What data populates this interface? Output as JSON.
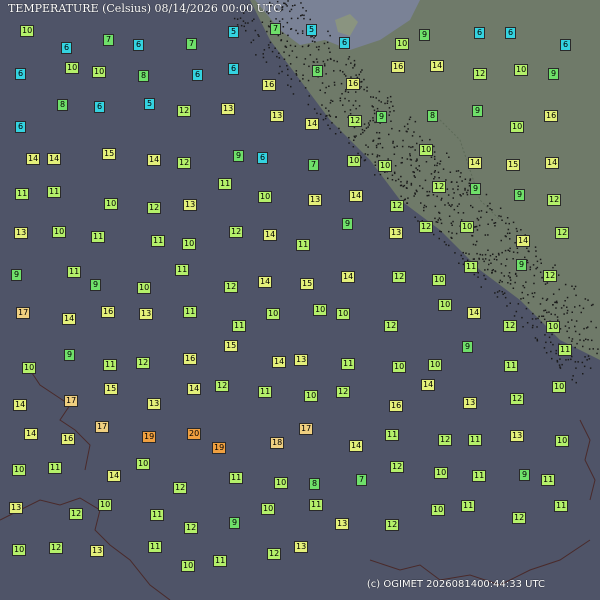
{
  "title": "TEMPERATURE (Celsius)   08/14/2026 00:00 UTC",
  "credit": "(c) OGIMET  2026081400:44:33 UTC",
  "colors": {
    "ocean": "#4f5468",
    "land": "#6f7a69",
    "land_light": "#8a9480",
    "water_body": "#7a8296",
    "border": "#4a2a2a",
    "t_cold": "#34d3e0",
    "t_cool": "#6fe06a",
    "t_mild": "#b4f06a",
    "t_warm": "#e4f07a",
    "t_hot": "#f0d080",
    "t_hotter": "#f0a040"
  },
  "stations": [
    {
      "t": 10
    },
    {
      "t": 6
    },
    {
      "t": 7
    },
    {
      "t": 6
    },
    {
      "t": 7
    },
    {
      "t": 5
    },
    {
      "t": 7
    },
    {
      "t": 5
    },
    {
      "t": 6
    },
    {
      "t": 10
    },
    {
      "t": 9
    },
    {
      "t": 6
    },
    {
      "t": 6
    },
    {
      "t": 6
    },
    {
      "t": 6
    },
    {
      "t": 10
    },
    {
      "t": 10
    },
    {
      "t": 8
    },
    {
      "t": 6
    },
    {
      "t": 6
    },
    {
      "t": 16
    },
    {
      "t": 8
    },
    {
      "t": 16
    },
    {
      "t": 16
    },
    {
      "t": 14
    },
    {
      "t": 12
    },
    {
      "t": 10
    },
    {
      "t": 9
    },
    {
      "t": 6
    },
    {
      "t": 8
    },
    {
      "t": 6
    },
    {
      "t": 5
    },
    {
      "t": 12
    },
    {
      "t": 13
    },
    {
      "t": 13
    },
    {
      "t": 14
    },
    {
      "t": 12
    },
    {
      "t": 9
    },
    {
      "t": 8
    },
    {
      "t": 9
    },
    {
      "t": 10
    },
    {
      "t": 16
    },
    {
      "t": 14
    },
    {
      "t": 14
    },
    {
      "t": 15
    },
    {
      "t": 14
    },
    {
      "t": 12
    },
    {
      "t": 9
    },
    {
      "t": 6
    },
    {
      "t": 7
    },
    {
      "t": 10
    },
    {
      "t": 10
    },
    {
      "t": 10
    },
    {
      "t": 14
    },
    {
      "t": 15
    },
    {
      "t": 14
    },
    {
      "t": 11
    },
    {
      "t": 11
    },
    {
      "t": 10
    },
    {
      "t": 12
    },
    {
      "t": 13
    },
    {
      "t": 11
    },
    {
      "t": 10
    },
    {
      "t": 13
    },
    {
      "t": 14
    },
    {
      "t": 12
    },
    {
      "t": 12
    },
    {
      "t": 9
    },
    {
      "t": 9
    },
    {
      "t": 12
    },
    {
      "t": 13
    },
    {
      "t": 10
    },
    {
      "t": 11
    },
    {
      "t": 11
    },
    {
      "t": 10
    },
    {
      "t": 12
    },
    {
      "t": 14
    },
    {
      "t": 11
    },
    {
      "t": 9
    },
    {
      "t": 13
    },
    {
      "t": 12
    },
    {
      "t": 10
    },
    {
      "t": 14
    },
    {
      "t": 12
    },
    {
      "t": 9
    },
    {
      "t": 11
    },
    {
      "t": 9
    },
    {
      "t": 10
    },
    {
      "t": 11
    },
    {
      "t": 12
    },
    {
      "t": 14
    },
    {
      "t": 15
    },
    {
      "t": 14
    },
    {
      "t": 12
    },
    {
      "t": 10
    },
    {
      "t": 11
    },
    {
      "t": 9
    },
    {
      "t": 12
    },
    {
      "t": 17
    },
    {
      "t": 14
    },
    {
      "t": 16
    },
    {
      "t": 13
    },
    {
      "t": 11
    },
    {
      "t": 11
    },
    {
      "t": 10
    },
    {
      "t": 10
    },
    {
      "t": 10
    },
    {
      "t": 12
    },
    {
      "t": 10
    },
    {
      "t": 14
    },
    {
      "t": 12
    },
    {
      "t": 10
    },
    {
      "t": 10
    },
    {
      "t": 9
    },
    {
      "t": 11
    },
    {
      "t": 12
    },
    {
      "t": 16
    },
    {
      "t": 15
    },
    {
      "t": 14
    },
    {
      "t": 13
    },
    {
      "t": 11
    },
    {
      "t": 10
    },
    {
      "t": 10
    },
    {
      "t": 9
    },
    {
      "t": 11
    },
    {
      "t": 11
    },
    {
      "t": 14
    },
    {
      "t": 17
    },
    {
      "t": 15
    },
    {
      "t": 13
    },
    {
      "t": 14
    },
    {
      "t": 12
    },
    {
      "t": 11
    },
    {
      "t": 10
    },
    {
      "t": 12
    },
    {
      "t": 16
    },
    {
      "t": 14
    },
    {
      "t": 13
    },
    {
      "t": 12
    },
    {
      "t": 10
    },
    {
      "t": 14
    },
    {
      "t": 16
    },
    {
      "t": 17
    },
    {
      "t": 19
    },
    {
      "t": 20
    },
    {
      "t": 19
    },
    {
      "t": 18
    },
    {
      "t": 17
    },
    {
      "t": 14
    },
    {
      "t": 11
    },
    {
      "t": 12
    },
    {
      "t": 11
    },
    {
      "t": 13
    },
    {
      "t": 10
    },
    {
      "t": 10
    },
    {
      "t": 11
    },
    {
      "t": 14
    },
    {
      "t": 10
    },
    {
      "t": 12
    },
    {
      "t": 11
    },
    {
      "t": 10
    },
    {
      "t": 8
    },
    {
      "t": 7
    },
    {
      "t": 12
    },
    {
      "t": 10
    },
    {
      "t": 11
    },
    {
      "t": 9
    },
    {
      "t": 11
    },
    {
      "t": 13
    },
    {
      "t": 12
    },
    {
      "t": 10
    },
    {
      "t": 11
    },
    {
      "t": 12
    },
    {
      "t": 9
    },
    {
      "t": 10
    },
    {
      "t": 11
    },
    {
      "t": 13
    },
    {
      "t": 12
    },
    {
      "t": 10
    },
    {
      "t": 11
    },
    {
      "t": 12
    },
    {
      "t": 11
    },
    {
      "t": 10
    },
    {
      "t": 12
    },
    {
      "t": 13
    },
    {
      "t": 11
    },
    {
      "t": 10
    },
    {
      "t": 11
    },
    {
      "t": 12
    },
    {
      "t": 13
    }
  ]
}
